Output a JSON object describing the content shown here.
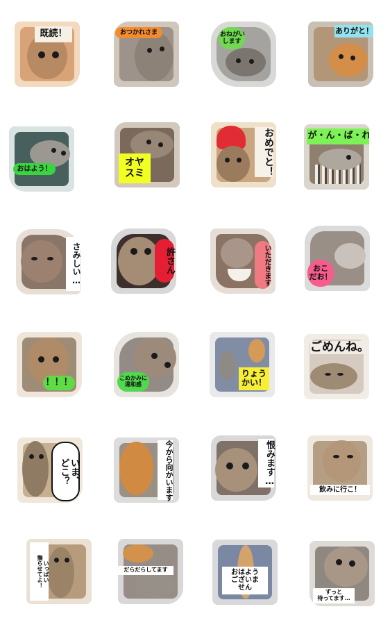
{
  "stickers": [
    {
      "caption": "既読！",
      "frame": "#f3d9bd",
      "photo": "#d8a377",
      "cat": "#b88a64",
      "label_bg": "#f6f0e6"
    },
    {
      "caption": "おつかれさま",
      "frame": "#cfc6bc",
      "photo": "#9d938a",
      "cat": "#8d8277",
      "label_bg": "#f48b2f"
    },
    {
      "caption": "おねがい\nします",
      "frame": "#d8d8d6",
      "photo": "#a5a39f",
      "cat": "#7b756f",
      "label_bg": "#6fda50"
    },
    {
      "caption": "ありがと！",
      "frame": "#c9c0b5",
      "photo": "#b39677",
      "cat": "#d58e48",
      "label_bg": "#93e2ef"
    },
    {
      "caption": "おはよう！",
      "frame": "#d9e3e2",
      "photo": "#47605d",
      "cat": "#9b9791",
      "label_bg": "#39d53f"
    },
    {
      "caption": "オヤ\nスミ",
      "frame": "#d3c8bd",
      "photo": "#7b6a5c",
      "cat": "#988777",
      "label_bg": "#f2ff23"
    },
    {
      "caption": "おめでと！",
      "frame": "#efe0c9",
      "photo": "#c9a680",
      "cat": "#9a7b5e",
      "label_bg": "#f7f2e9"
    },
    {
      "caption": "が・ん・ば・れ",
      "frame": "#dad5cd",
      "photo": "#8e7f6f",
      "cat": "#aea79d",
      "label_bg": "#7df257"
    },
    {
      "caption": "さみしい…",
      "frame": "#e7dfd5",
      "photo": "#8a7668",
      "cat": "#9d8170",
      "label_bg": "#ffffff"
    },
    {
      "caption": "許さん",
      "frame": "#d8d8d8",
      "photo": "#3d2f2b",
      "cat": "#a48c75",
      "label_bg": "#e51e33"
    },
    {
      "caption": "いただきます",
      "frame": "#e5ded7",
      "photo": "#8b7364",
      "cat": "#a9958a",
      "label_bg": "#f07a82"
    },
    {
      "caption": "おこ\nだお！",
      "frame": "#dbdbdb",
      "photo": "#9a8f86",
      "cat": "#c9c2bc",
      "label_bg": "#f65d8e"
    },
    {
      "caption": "！！！",
      "frame": "#efe6db",
      "photo": "#9f8c76",
      "cat": "#b08b68",
      "label_bg": "#5ddd43"
    },
    {
      "caption": "こめかみに\n違和感",
      "frame": "#e7e3de",
      "photo": "#938b85",
      "cat": "#9c8b7b",
      "label_bg": "#50d94d"
    },
    {
      "caption": "りょう\nかい！",
      "frame": "#e9e9ea",
      "photo": "#818ca5",
      "cat": "#d49a58",
      "label_bg": "#f6ef36"
    },
    {
      "caption": "ごめんね。",
      "frame": "#f1ece5",
      "photo": "#d5cbc0",
      "cat": "#9f8a74",
      "label_bg": "#f1ece5"
    },
    {
      "caption": "いま、\nどこ？",
      "frame": "#efe7da",
      "photo": "#c7b08f",
      "cat": "#8f7a64",
      "label_bg": "#ffffff"
    },
    {
      "caption": "今から向かいます",
      "frame": "#dcdcdc",
      "photo": "#9a9084",
      "cat": "#d08a42",
      "label_bg": "#ffffff"
    },
    {
      "caption": "恨みます…",
      "frame": "#d8d8d8",
      "photo": "#7f7168",
      "cat": "#a8917a",
      "label_bg": "#ffffff"
    },
    {
      "caption": "飲みに行こ！",
      "frame": "#efe8de",
      "photo": "#b59f84",
      "cat": "#b49678",
      "label_bg": "#ffffff"
    },
    {
      "caption": "いっぱい\n撫らせてよ！",
      "frame": "#eae0d4",
      "photo": "#b69b7c",
      "cat": "#9b8368",
      "label_bg": "#ffffff"
    },
    {
      "caption": "だらだらしてます",
      "frame": "#d8d8d8",
      "photo": "#968e86",
      "cat": "#d3924c",
      "label_bg": "#ffffff"
    },
    {
      "caption": "おはよう\nございま\nせん",
      "frame": "#d9d9db",
      "photo": "#7b88a3",
      "cat": "#d4a36c",
      "label_bg": "#ffffff"
    },
    {
      "caption": "ずっと\n待ってます…",
      "frame": "#dedbd7",
      "photo": "#8f8880",
      "cat": "#a89686",
      "label_bg": "#ffffff"
    }
  ]
}
